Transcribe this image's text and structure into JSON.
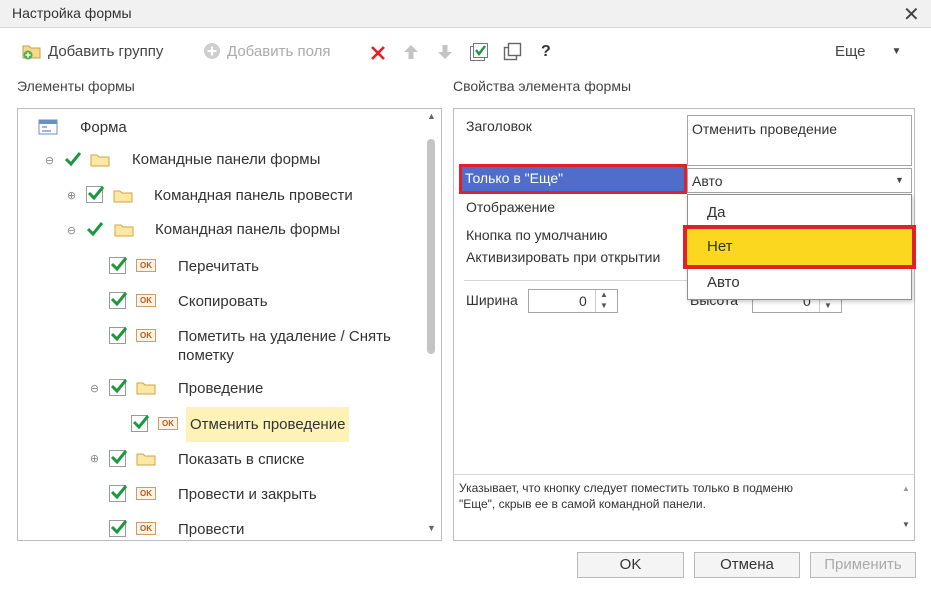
{
  "window": {
    "title": "Настройка формы"
  },
  "toolbar": {
    "add_group": "Добавить группу",
    "add_fields": "Добавить поля",
    "more": "Еще",
    "help": "?"
  },
  "left": {
    "header": "Элементы формы",
    "tree": [
      {
        "label": "Форма"
      },
      {
        "label": "Командные панели формы"
      },
      {
        "label": "Командная панель провести"
      },
      {
        "label": "Командная панель формы"
      },
      {
        "label": "Перечитать"
      },
      {
        "label": "Скопировать"
      },
      {
        "label": "Пометить на удаление / Снять",
        "label2": "пометку"
      },
      {
        "label": "Проведение"
      },
      {
        "label": "Отменить проведение"
      },
      {
        "label": "Показать в списке"
      },
      {
        "label": "Провести и закрыть"
      },
      {
        "label": "Провести"
      }
    ]
  },
  "right": {
    "header": "Свойства элемента формы",
    "props": {
      "title_label": "Заголовок",
      "title_value": "Отменить проведение",
      "only_more_label": "Только в \"Еще\"",
      "only_more_value": "Авто",
      "display_label": "Отображение",
      "default_button_label": "Кнопка по умолчанию",
      "activate_label": "Активизировать при открытии",
      "width_label": "Ширина",
      "width_value": "0",
      "height_label": "Высота",
      "height_value": "0"
    },
    "dropdown": [
      "Да",
      "Нет",
      "Авто"
    ],
    "hint_line1": "Указывает, что кнопку следует поместить только в подменю",
    "hint_line2": "\"Еще\", скрыв ее в самой командной панели."
  },
  "footer": {
    "ok": "OK",
    "cancel": "Отмена",
    "apply": "Применить"
  },
  "colors": {
    "highlight_red": "#e2202a",
    "selected_blue": "#4f6dc9",
    "dropdown_yellow": "#fbd81f",
    "selection_yellow": "#fdf3b6"
  }
}
